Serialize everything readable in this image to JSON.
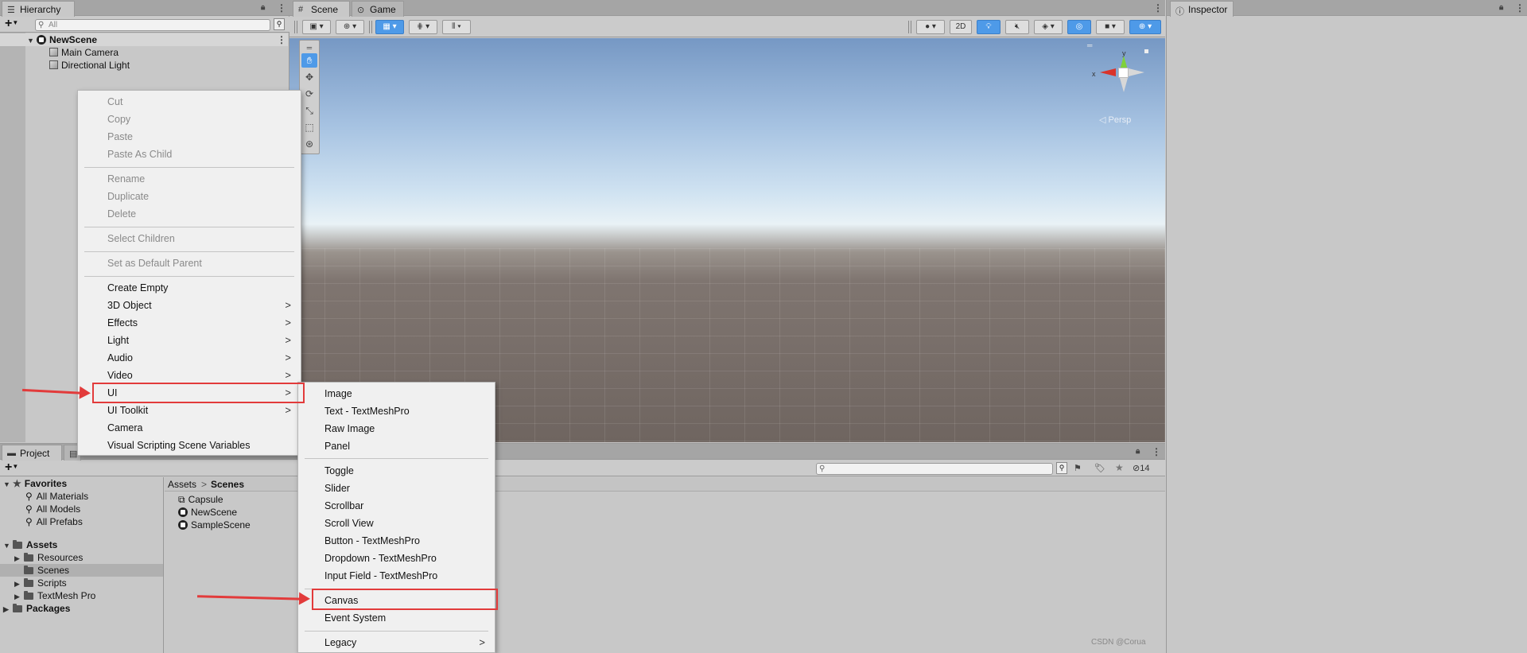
{
  "hierarchy": {
    "tab_label": "Hierarchy",
    "add_label": "+",
    "search_placeholder": "All",
    "scene_name": "NewScene",
    "items": [
      "Main Camera",
      "Directional Light"
    ]
  },
  "scene": {
    "tabs": [
      "Scene",
      "Game"
    ],
    "toggle_2d": "2D",
    "persp_label": "◁ Persp",
    "gizmo_axes": {
      "x": "x",
      "y": "y"
    }
  },
  "inspector": {
    "tab_label": "Inspector"
  },
  "project": {
    "tab_label": "Project",
    "add_label": "+",
    "hidden_count": "14",
    "favorites_label": "Favorites",
    "favorites": [
      "All Materials",
      "All Models",
      "All Prefabs"
    ],
    "assets_label": "Assets",
    "asset_folders": [
      "Resources",
      "Scenes",
      "Scripts",
      "TextMesh Pro"
    ],
    "packages_label": "Packages",
    "breadcrumb": [
      "Assets",
      "Scenes"
    ],
    "breadcrumb_sep": ">",
    "files": [
      "Capsule",
      "NewScene",
      "SampleScene"
    ]
  },
  "context_menu": {
    "group1": [
      "Cut",
      "Copy",
      "Paste",
      "Paste As Child"
    ],
    "group2": [
      "Rename",
      "Duplicate",
      "Delete"
    ],
    "group3": [
      "Select Children"
    ],
    "group4": [
      "Set as Default Parent"
    ],
    "group5": [
      "Create Empty",
      "3D Object",
      "Effects",
      "Light",
      "Audio",
      "Video",
      "UI",
      "UI Toolkit",
      "Camera",
      "Visual Scripting Scene Variables"
    ],
    "arrow": ">"
  },
  "ui_submenu": {
    "group1": [
      "Image",
      "Text - TextMeshPro",
      "Raw Image",
      "Panel"
    ],
    "group2": [
      "Toggle",
      "Slider",
      "Scrollbar",
      "Scroll View",
      "Button - TextMeshPro",
      "Dropdown - TextMeshPro",
      "Input Field - TextMeshPro"
    ],
    "group3": [
      "Canvas",
      "Event System"
    ],
    "group4": [
      "Legacy"
    ],
    "arrow": ">"
  },
  "watermark": "CSDN @Corua",
  "colors": {
    "highlight": "#e23b3b",
    "accent": "#4e9ae8"
  }
}
